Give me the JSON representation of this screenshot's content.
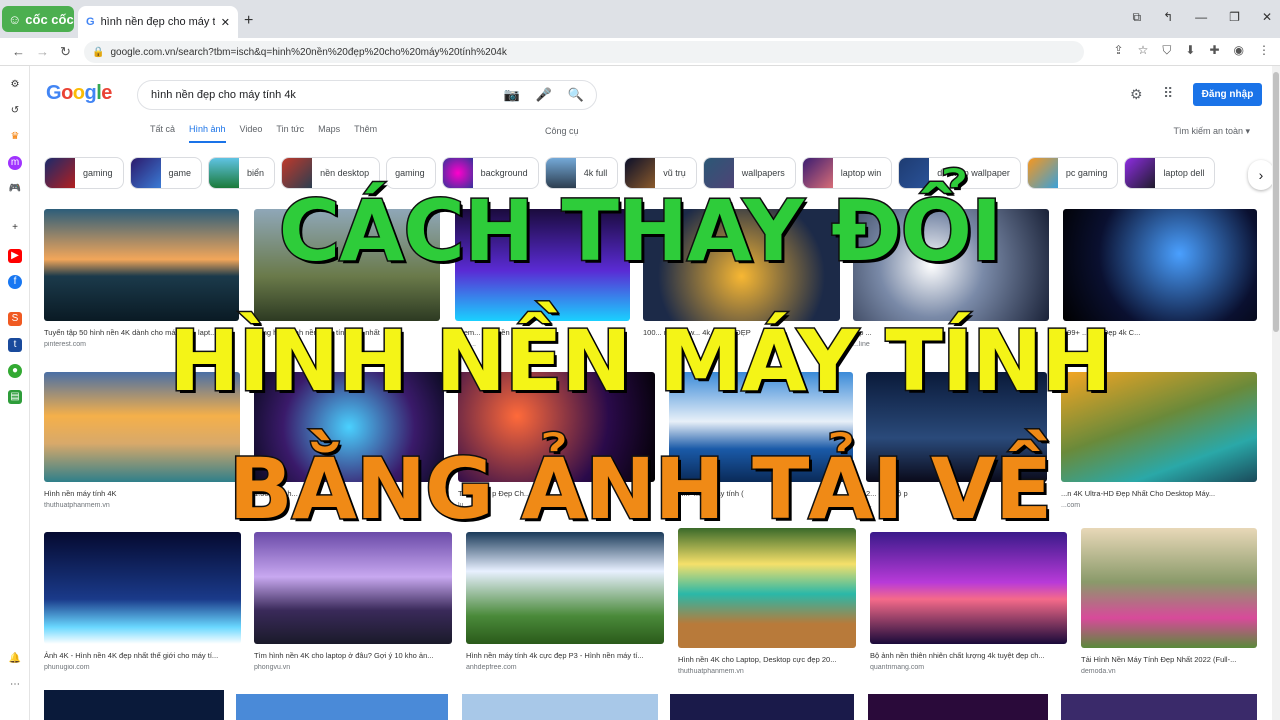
{
  "browser": {
    "brand": "cốc cốc",
    "tab_title": "hình nền đẹp cho máy tính 4",
    "url": "google.com.vn/search?tbm=isch&q=hinh%20nền%20đẹp%20cho%20máy%20tính%204k"
  },
  "google": {
    "logo": "Google",
    "query": "hình nền đẹp cho máy tính 4k",
    "login": "Đăng nhập",
    "tabs": [
      {
        "label": "Tất cả"
      },
      {
        "label": "Hình ảnh"
      },
      {
        "label": "Video"
      },
      {
        "label": "Tin tức"
      },
      {
        "label": "Maps"
      },
      {
        "label": "Thêm"
      }
    ],
    "tools": "Công cụ",
    "safe_search": "Tìm kiếm an toàn ▾",
    "chips": [
      "gaming",
      "game",
      "biển",
      "nền desktop",
      "gaming",
      "background",
      "4k full",
      "vũ trụ",
      "wallpapers",
      "laptop win",
      "desktop wallpaper",
      "pc gaming",
      "laptop dell"
    ]
  },
  "results": [
    {
      "caption": "Tuyển tập 50 hình nền 4K dành cho máy tính, lapt...",
      "source": "pinterest.com"
    },
    {
      "caption": "Tổng hợp hình nền máy tính đẹp nhất",
      "source": ""
    },
    {
      "caption": "Them... ảnh nền máy...",
      "source": "mayt..."
    },
    {
      "caption": "100... nh nền w... 4k fu... Ư ĐẸP",
      "source": ""
    },
    {
      "caption": "...p ...",
      "source": "...line"
    },
    {
      "caption": "999+ ...nền Đẹp 4k C...",
      "source": ""
    },
    {
      "caption": "Hình nền máy tính 4K",
      "source": "thuthuatphanmem.vn"
    },
    {
      "caption": "1.50... hình... ep",
      "source": ""
    },
    {
      "caption": "T... Nền... p Đẹp Ch... 4",
      "source": "lu..."
    },
    {
      "caption": "... hì... 4k ... máy tính (",
      "source": "p..."
    },
    {
      "caption": "2... đẹp độ p",
      "source": "..."
    },
    {
      "caption": "...n 4K Ultra-HD Đẹp Nhất Cho Desktop Máy...",
      "source": "...com"
    },
    {
      "caption": "Ảnh 4K - Hình nền 4K đẹp nhất thế giới cho máy tí...",
      "source": "phunugioi.com"
    },
    {
      "caption": "Tìm hình nền 4K cho laptop ở đâu? Gợi ý 10 kho ản...",
      "source": "phongvu.vn"
    },
    {
      "caption": "Hình nền máy tính 4k cực đẹp P3 - Hình nền máy tí...",
      "source": "anhdepfree.com"
    },
    {
      "caption": "Hình nền 4K cho Laptop, Desktop cực đẹp 20...",
      "source": "thuthuatphanmem.vn"
    },
    {
      "caption": "Bộ ảnh nền thiên nhiên chất lượng 4k tuyệt đẹp ch...",
      "source": "quantrimang.com"
    },
    {
      "caption": "Tải Hình Nền Máy Tính Đẹp Nhất 2022 (Full-...",
      "source": "demoda.vn"
    }
  ],
  "overlay": {
    "line1": "CÁCH THAY ĐỔI",
    "line2": "HÌNH NỀN MÁY TÍNH",
    "line3": "BẰNG ẢNH TẢI VỀ"
  },
  "colors": {
    "overlay1": "#2ecc3a",
    "overlay2": "#f4f417",
    "overlay3": "#f08a16",
    "accent": "#1a73e8"
  }
}
